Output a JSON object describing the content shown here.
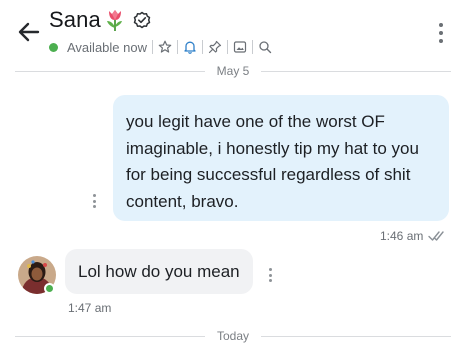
{
  "header": {
    "contact_name": "Sana",
    "name_emoji": "tulip",
    "verified_icon": "verified-check-icon",
    "status": "Available now",
    "status_color": "#4caf50",
    "toolbar_icons": [
      "star-icon",
      "bell-icon",
      "pin-icon",
      "media-icon",
      "search-icon"
    ],
    "accent_color": "#2f80c9"
  },
  "dividers": {
    "first": "May 5",
    "second": "Today"
  },
  "messages": [
    {
      "direction": "outgoing",
      "text": "you legit have one of the worst OF imaginable, i honestly tip my hat to you for being successful regardless of shit content, bravo.",
      "time": "1:46 am",
      "read_receipt": "double-check-icon",
      "bubble_color": "#e3f2fc"
    },
    {
      "direction": "incoming",
      "text": "Lol how do you mean",
      "time": "1:47 am",
      "bubble_color": "#f1f2f4"
    }
  ]
}
